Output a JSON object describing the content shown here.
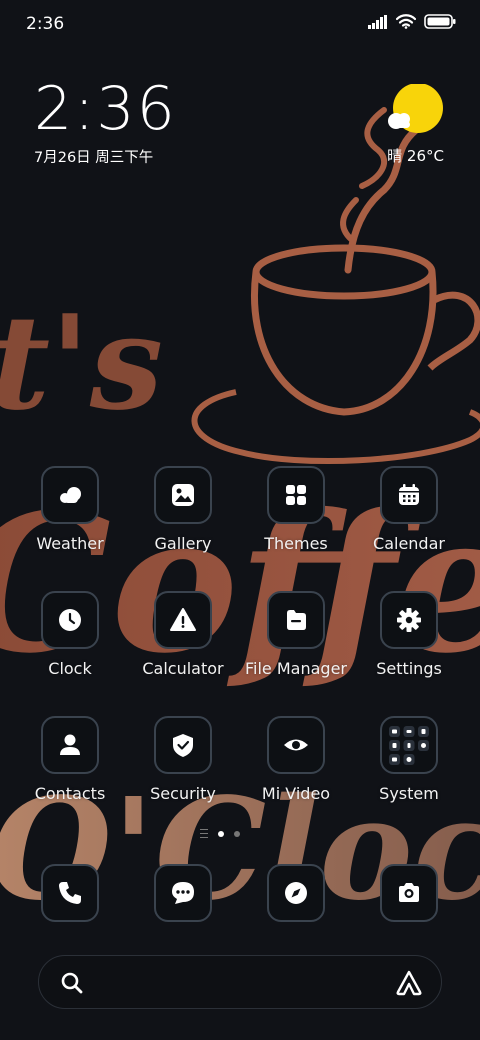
{
  "status_bar": {
    "time": "2:36"
  },
  "lock_clock": {
    "time": "2:36",
    "date": "7月26日 周三下午"
  },
  "weather": {
    "text": "晴 26°C",
    "sun_color": "#f8d40a"
  },
  "wallpaper": {
    "line1": "t's",
    "line2": "Coffee",
    "line3": "O'Clock",
    "accent_color": "#a85f44"
  },
  "apps": [
    {
      "label": "Weather",
      "icon": "weather-icon"
    },
    {
      "label": "Gallery",
      "icon": "gallery-icon"
    },
    {
      "label": "Themes",
      "icon": "themes-icon"
    },
    {
      "label": "Calendar",
      "icon": "calendar-icon"
    },
    {
      "label": "Clock",
      "icon": "clock-icon"
    },
    {
      "label": "Calculator",
      "icon": "calculator-icon"
    },
    {
      "label": "File Manager",
      "icon": "file-manager-icon"
    },
    {
      "label": "Settings",
      "icon": "settings-icon"
    },
    {
      "label": "Contacts",
      "icon": "contacts-icon"
    },
    {
      "label": "Security",
      "icon": "security-icon"
    },
    {
      "label": "Mi Video",
      "icon": "mi-video-icon"
    },
    {
      "label": "System",
      "icon": "system-folder-icon"
    }
  ],
  "dock": [
    {
      "icon": "phone-icon"
    },
    {
      "icon": "messaging-icon"
    },
    {
      "icon": "browser-icon"
    },
    {
      "icon": "camera-icon"
    }
  ],
  "pager": {
    "pages": 2,
    "current": 1
  },
  "search": {
    "placeholder": ""
  }
}
